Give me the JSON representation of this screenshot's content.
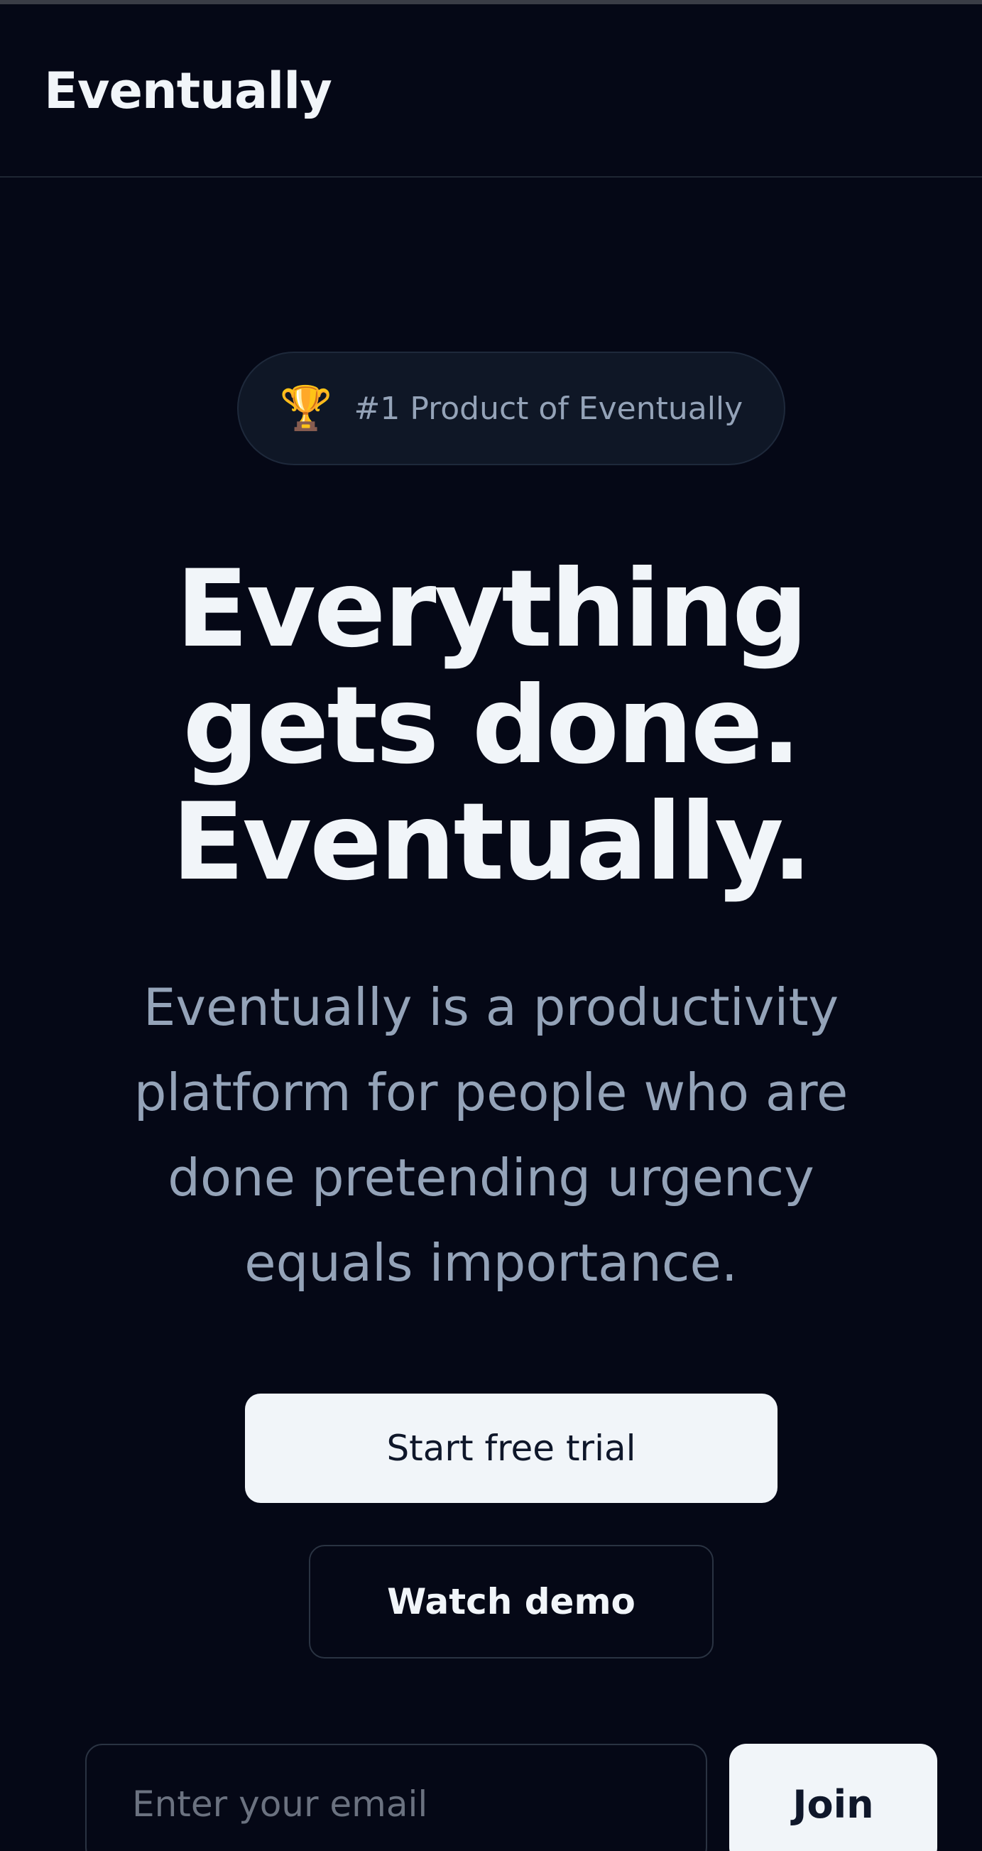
{
  "header": {
    "logo": "Eventually"
  },
  "badge": {
    "icon": "trophy-icon",
    "text": "#1 Product of Eventually"
  },
  "hero": {
    "title_lines": [
      "Everything",
      "gets done.",
      "Eventually."
    ],
    "subtitle": "Eventually is a productivity platform for people who are done pretending urgency equals importance."
  },
  "actions": {
    "primary_label": "Start free trial",
    "secondary_label": "Watch demo"
  },
  "signup": {
    "email_placeholder": "Enter your email",
    "email_value": "",
    "join_label": "Join"
  },
  "colors": {
    "background": "#050816",
    "text_primary": "#f1f5f9",
    "text_muted": "#94a3b8",
    "button_light": "#f1f5f9"
  }
}
